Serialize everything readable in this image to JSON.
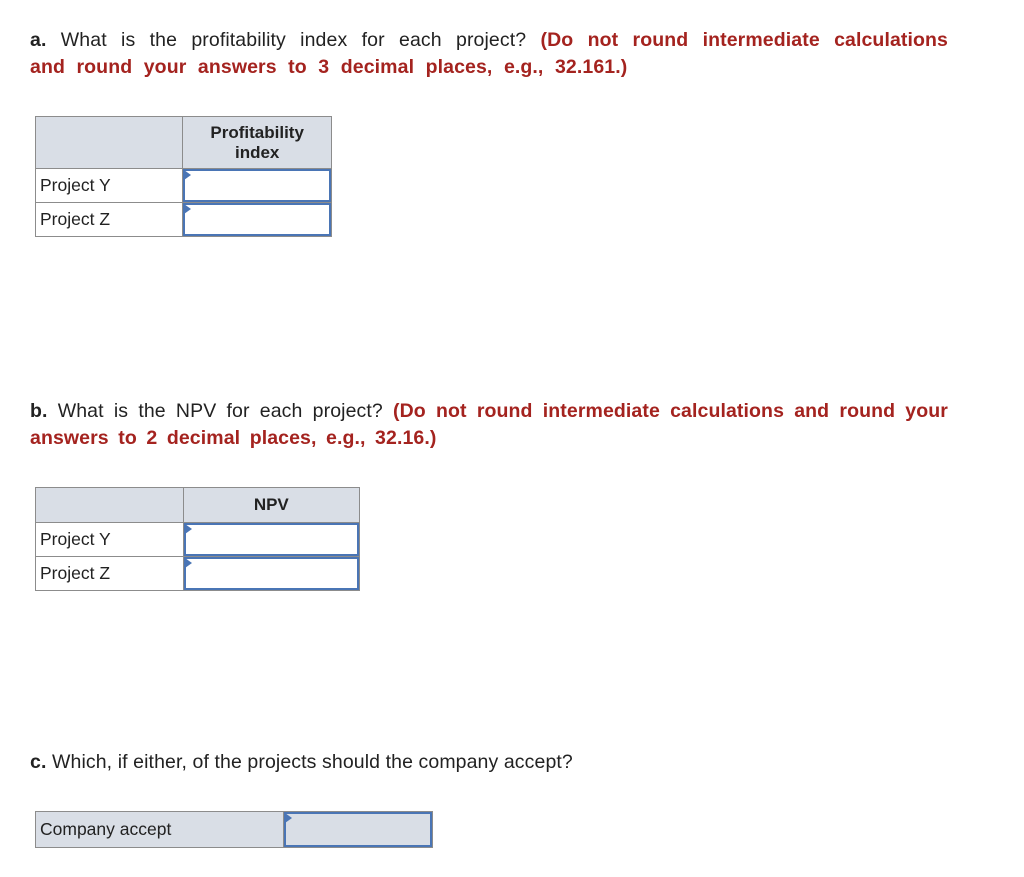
{
  "part_a": {
    "letter": "a.",
    "question": "What is the profitability index for each project?",
    "instruction": "(Do not round intermediate calculations and round your answers to 3 decimal places, e.g., 32.161.)",
    "table": {
      "header": [
        "",
        "Profitability index"
      ],
      "rows": [
        {
          "label": "Project Y",
          "value": ""
        },
        {
          "label": "Project Z",
          "value": ""
        }
      ]
    }
  },
  "part_b": {
    "letter": "b.",
    "question": "What is the NPV for each project?",
    "instruction": "(Do not round intermediate calculations and round your answers to 2 decimal places, e.g., 32.16.)",
    "table": {
      "header": [
        "",
        "NPV"
      ],
      "rows": [
        {
          "label": "Project Y",
          "value": ""
        },
        {
          "label": "Project Z",
          "value": ""
        }
      ]
    }
  },
  "part_c": {
    "letter": "c.",
    "question": "Which, if either, of the projects should the company accept?",
    "table": {
      "rows": [
        {
          "label": "Company accept",
          "value": ""
        }
      ]
    }
  },
  "colors": {
    "instruction_red": "#a4231f",
    "input_border_blue": "#4a75b5",
    "header_fill": "#d9dee6",
    "grid_border": "#8c8c8c"
  }
}
